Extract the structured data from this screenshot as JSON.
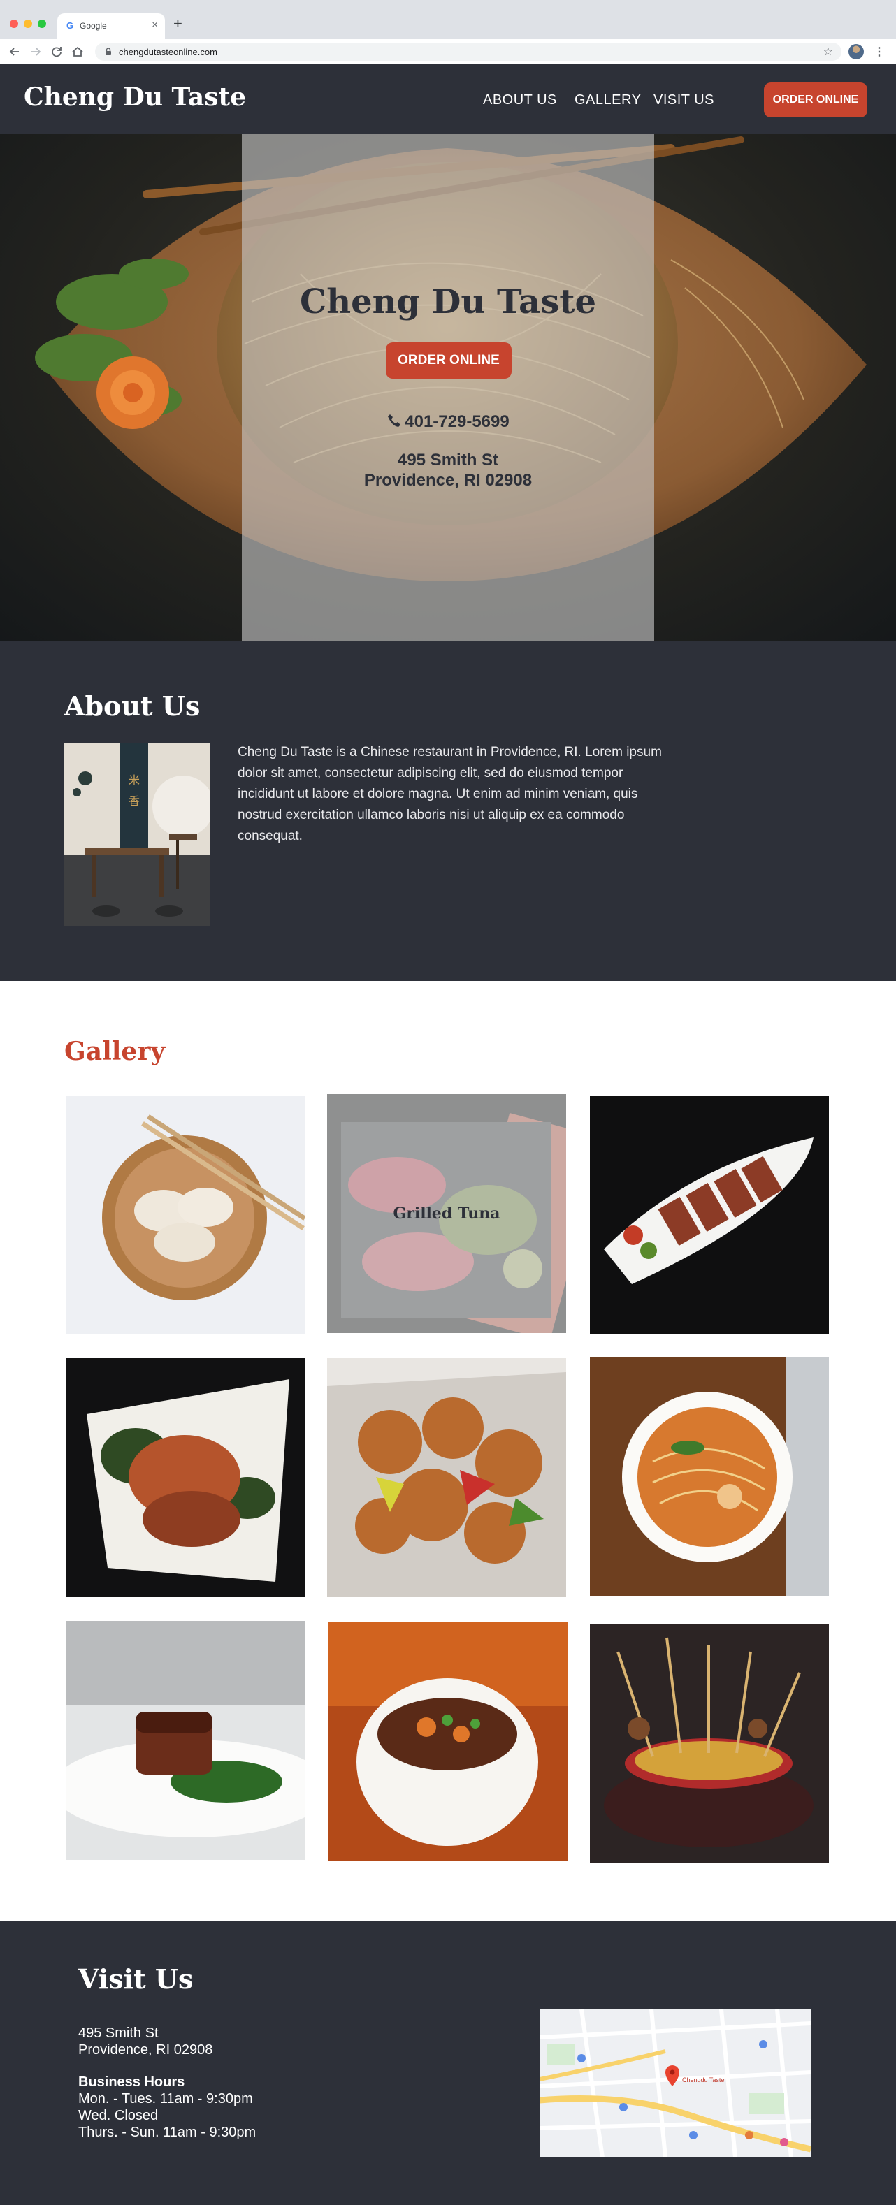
{
  "browser": {
    "tab_title": "Google",
    "tab_favicon": "G",
    "url": "chengdutasteonline.com"
  },
  "header": {
    "brand": "Cheng Du Taste",
    "nav": [
      "ABOUT US",
      "GALLERY",
      "VISIT US"
    ],
    "order_label": "ORDER ONLINE"
  },
  "hero": {
    "title": "Cheng Du Taste",
    "order_label": "ORDER ONLINE",
    "phone": "401-729-5699",
    "address_line1": "495 Smith St",
    "address_line2": "Providence, RI 02908"
  },
  "about": {
    "title": "About Us",
    "text": "Cheng Du Taste is a Chinese restaurant in Providence, RI. Lorem ipsum dolor sit amet, consectetur adipiscing elit, sed do eiusmod tempor incididunt ut labore et dolore magna. Ut enim ad minim veniam, quis nostrud exercitation ullamco laboris nisi ut aliquip ex ea commodo consequat."
  },
  "gallery": {
    "title": "Gallery",
    "hover_caption": "Grilled Tuna"
  },
  "visit": {
    "title": "Visit Us",
    "address_line1": "495 Smith St",
    "address_line2": "Providence, RI 02908",
    "hours_title": "Business Hours",
    "hours": [
      "Mon. - Tues. 11am - 9:30pm",
      "Wed.  Closed",
      "Thurs. - Sun.  11am - 9:30pm"
    ],
    "map_pin_label": "Chengdu Taste"
  },
  "colors": {
    "accent": "#c7442e",
    "dark": "#2d3039",
    "light": "#ffffff"
  }
}
